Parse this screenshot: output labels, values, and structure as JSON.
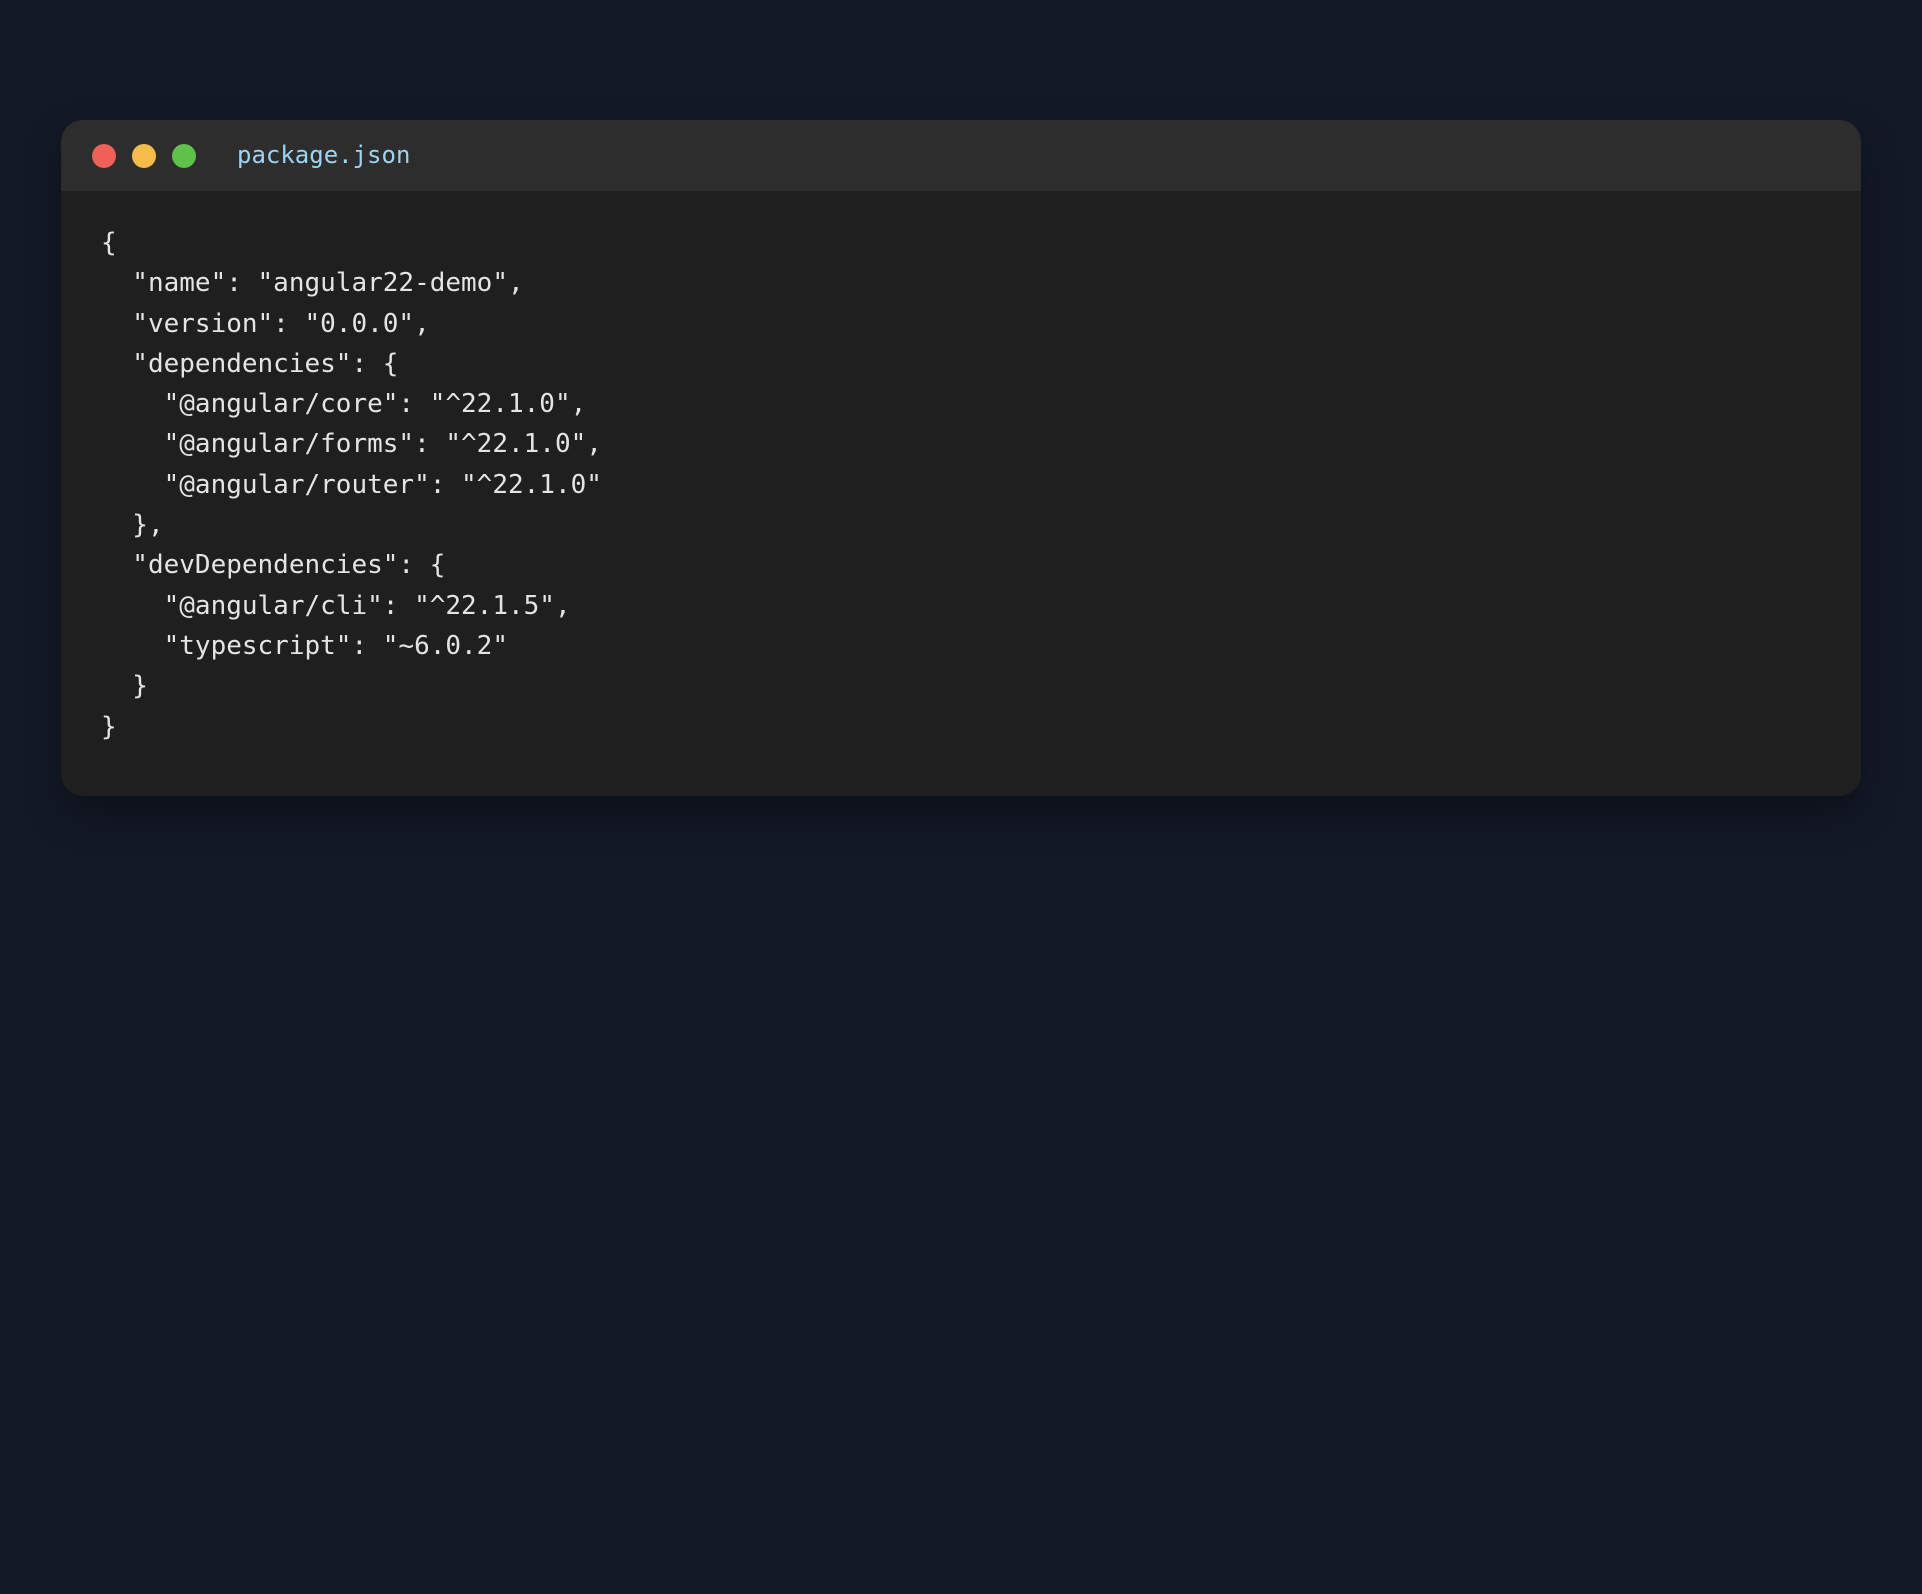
{
  "window": {
    "title": "package.json",
    "controls": {
      "close_color": "#ef6058",
      "minimize_color": "#f6bc4b",
      "zoom_color": "#5ec24a"
    }
  },
  "code": {
    "language": "json",
    "lines": [
      "{",
      "  \"name\": \"angular22-demo\",",
      "  \"version\": \"0.0.0\",",
      "  \"dependencies\": {",
      "    \"@angular/core\": \"^22.1.0\",",
      "    \"@angular/forms\": \"^22.1.0\",",
      "    \"@angular/router\": \"^22.1.0\"",
      "  },",
      "  \"devDependencies\": {",
      "    \"@angular/cli\": \"^22.1.5\",",
      "    \"typescript\": \"~6.0.2\"",
      "  }",
      "}"
    ]
  }
}
